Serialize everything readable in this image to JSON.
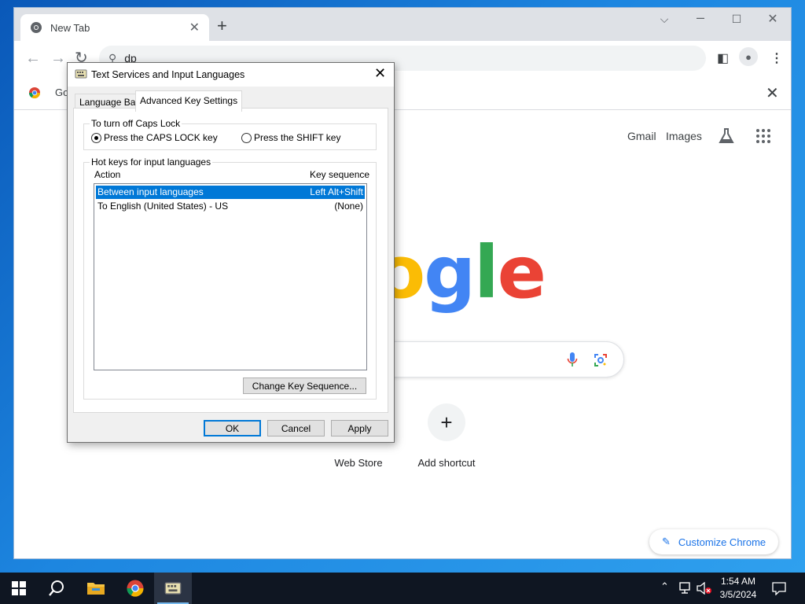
{
  "chrome": {
    "tab_title": "New Tab",
    "tab_close": "✕",
    "new_tab": "+",
    "omnibox_text": "dp",
    "infobar_text": "Go",
    "infobar_close": "✕",
    "ntp": {
      "gmail": "Gmail",
      "images": "Images",
      "logo_letters": [
        "o",
        "g",
        "l",
        "e"
      ],
      "shortcuts": [
        {
          "label": "Web Store",
          "icon": "web-store-icon"
        },
        {
          "label": "Add shortcut",
          "icon": "plus-icon",
          "glyph": "+"
        }
      ],
      "customize_label": "Customize Chrome"
    }
  },
  "dialog": {
    "title": "Text Services and Input Languages",
    "close": "✕",
    "tabs": [
      "Language Bar",
      "Advanced Key Settings"
    ],
    "active_tab": "Advanced Key Settings",
    "caps_group": {
      "label": "To turn off Caps Lock",
      "option1": "Press the CAPS LOCK key",
      "option2": "Press the SHIFT key",
      "selected": "Press the CAPS LOCK key"
    },
    "hotkeys_group": {
      "label": "Hot keys for input languages",
      "col_action": "Action",
      "col_key": "Key sequence",
      "rows": [
        {
          "action": "Between input languages",
          "key": "Left Alt+Shift",
          "selected": true
        },
        {
          "action": "To English (United States) - US",
          "key": "(None)",
          "selected": false
        }
      ],
      "change_button": "Change Key Sequence..."
    },
    "buttons": {
      "ok": "OK",
      "cancel": "Cancel",
      "apply": "Apply"
    }
  },
  "taskbar": {
    "time": "1:54 AM",
    "date": "3/5/2024",
    "colors": {
      "accent": "#0078d7",
      "taskbar_bg": "#0f1622"
    }
  }
}
